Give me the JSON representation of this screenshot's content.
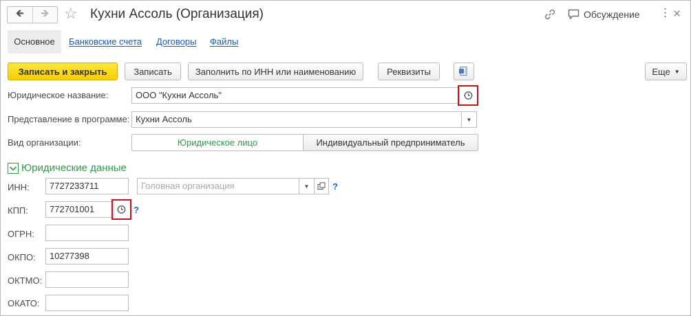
{
  "window": {
    "title": "Кухни Ассоль (Организация)",
    "discussion_label": "Обсуждение"
  },
  "tabs": [
    {
      "label": "Основное"
    },
    {
      "label": "Банковские счета"
    },
    {
      "label": "Договоры"
    },
    {
      "label": "Файлы"
    }
  ],
  "toolbar": {
    "save_close": "Записать и закрыть",
    "save": "Записать",
    "fill_inn": "Заполнить по ИНН или наименованию",
    "requisites": "Реквизиты",
    "more": "Еще"
  },
  "form": {
    "legal_name": {
      "label": "Юридическое название:",
      "value": "ООО \"Кухни Ассоль\""
    },
    "display_name": {
      "label": "Представление в программе:",
      "value": "Кухни Ассоль"
    },
    "org_type": {
      "label": "Вид организации:",
      "options": [
        "Юридическое лицо",
        "Индивидуальный предприниматель"
      ],
      "selected": "Юридическое лицо"
    }
  },
  "legal_data": {
    "title": "Юридические данные",
    "inn": {
      "label": "ИНН:",
      "value": "7727233711"
    },
    "head_org": {
      "placeholder": "Головная организация"
    },
    "kpp": {
      "label": "КПП:",
      "value": "772701001"
    },
    "ogrn": {
      "label": "ОГРН:",
      "value": ""
    },
    "okpo": {
      "label": "ОКПО:",
      "value": "10277398"
    },
    "oktmo": {
      "label": "ОКТМО:",
      "value": ""
    },
    "okato": {
      "label": "ОКАТО:",
      "value": ""
    },
    "help_mark": "?"
  },
  "colors": {
    "accent_green": "#2e9a4a",
    "link_blue": "#1a5aa5",
    "primary_yellow": "#f6cf00",
    "highlight_red": "#c0121f"
  }
}
